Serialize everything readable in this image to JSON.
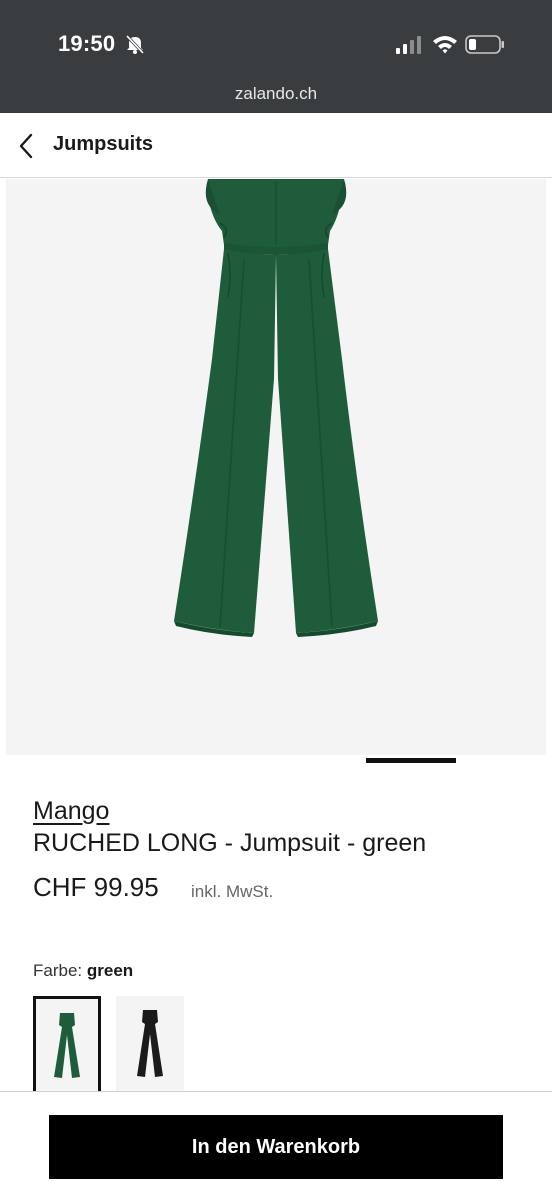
{
  "status_bar": {
    "time": "19:50",
    "icons": [
      "bell-off-icon",
      "signal-icon",
      "wifi-icon",
      "battery-icon"
    ]
  },
  "browser": {
    "url": "zalando.ch"
  },
  "header": {
    "back_icon": "chevron-left-icon",
    "title": "Jumpsuits"
  },
  "gallery": {
    "current_index": 1
  },
  "product": {
    "brand": "Mango",
    "name": "RUCHED LONG - Jumpsuit - green",
    "price": "CHF 99.95",
    "tax_note": "inkl. MwSt.",
    "color_label": "Farbe:",
    "color_value": "green",
    "swatches": [
      {
        "color": "#1f5c3c",
        "selected": true
      },
      {
        "color": "#1b1b1b",
        "selected": false
      }
    ]
  },
  "cta": {
    "label": "In den Warenkorb"
  },
  "colors": {
    "top_bar": "#3a3d3f",
    "image_bg": "#f4f4f4",
    "garment": "#1f5c3c",
    "button": "#000000"
  }
}
